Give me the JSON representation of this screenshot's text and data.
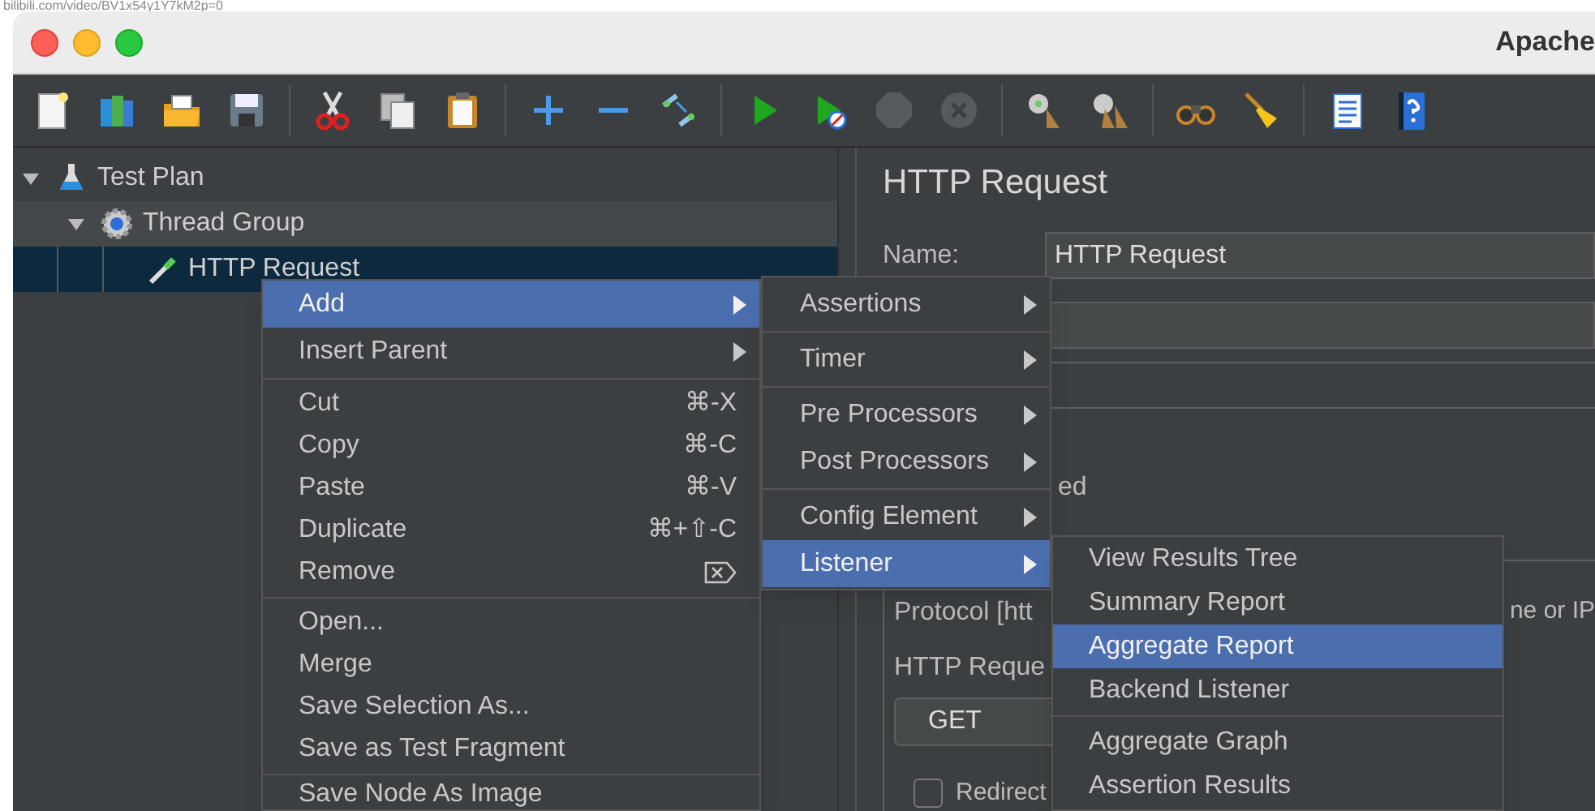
{
  "browser_strip": {
    "url": "bilibili.com/video/BV1x54y1Y7kM2p=0"
  },
  "window": {
    "title": "Apache"
  },
  "toolbar": [
    {
      "kind": "new",
      "disabled": false
    },
    {
      "kind": "templates",
      "disabled": false
    },
    {
      "kind": "open",
      "disabled": false
    },
    {
      "kind": "save",
      "disabled": false
    },
    {
      "kind": "separator"
    },
    {
      "kind": "cut",
      "disabled": false
    },
    {
      "kind": "copy",
      "disabled": false
    },
    {
      "kind": "paste",
      "disabled": false
    },
    {
      "kind": "separator"
    },
    {
      "kind": "expand",
      "disabled": false
    },
    {
      "kind": "collapse",
      "disabled": false
    },
    {
      "kind": "toggle",
      "disabled": false
    },
    {
      "kind": "separator"
    },
    {
      "kind": "start",
      "disabled": false
    },
    {
      "kind": "start-no-pause",
      "disabled": false
    },
    {
      "kind": "stop",
      "disabled": true
    },
    {
      "kind": "shutdown",
      "disabled": true
    },
    {
      "kind": "separator"
    },
    {
      "kind": "clear",
      "disabled": false
    },
    {
      "kind": "clear-all",
      "disabled": false
    },
    {
      "kind": "separator"
    },
    {
      "kind": "search",
      "disabled": false
    },
    {
      "kind": "reset-search",
      "disabled": false
    },
    {
      "kind": "separator"
    },
    {
      "kind": "function-helper",
      "disabled": false
    },
    {
      "kind": "help",
      "disabled": false
    }
  ],
  "tree": [
    {
      "label": "Test Plan",
      "kind": "test-plan",
      "expanded": true,
      "selected": false,
      "children": [
        {
          "label": "Thread Group",
          "kind": "thread-group",
          "expanded": true,
          "selected": false,
          "children": [
            {
              "label": "HTTP Request",
              "kind": "sampler",
              "selected": true
            }
          ]
        }
      ]
    }
  ],
  "editor": {
    "title": "HTTP Request",
    "name_label": "Name:",
    "name_value": "HTTP Request",
    "row_fragment": "ed",
    "protocol_label": "Protocol [htt",
    "server_label_fragment": "ne or IP",
    "section_label": "HTTP Reque",
    "method_value": "GET",
    "redirect": {
      "label": "Redirect",
      "checked": false
    }
  },
  "context_menu": {
    "groups": [
      [
        {
          "label": "Add",
          "kind": "submenu",
          "selected": true
        },
        {
          "label": "Insert Parent",
          "kind": "submenu",
          "selected": false
        }
      ],
      [
        {
          "label": "Cut",
          "kind": "shortcut",
          "shortcut": "⌘-X",
          "selected": false
        },
        {
          "label": "Copy",
          "kind": "shortcut",
          "shortcut": "⌘-C",
          "selected": false
        },
        {
          "label": "Paste",
          "kind": "shortcut",
          "shortcut": "⌘-V",
          "selected": false
        },
        {
          "label": "Duplicate",
          "kind": "shortcut",
          "shortcut": "⌘+⇧-C",
          "selected": false
        },
        {
          "label": "Remove",
          "kind": "delete-shortcut",
          "selected": false
        }
      ],
      [
        {
          "label": "Open...",
          "kind": "plain",
          "selected": false
        },
        {
          "label": "Merge",
          "kind": "plain",
          "selected": false
        },
        {
          "label": "Save Selection As...",
          "kind": "plain",
          "selected": false
        },
        {
          "label": "Save as Test Fragment",
          "kind": "plain",
          "selected": false
        }
      ],
      [
        {
          "label": "Save Node As Image",
          "kind": "plain",
          "selected": false
        }
      ]
    ]
  },
  "add_submenu": {
    "groups": [
      [
        {
          "label": "Assertions",
          "kind": "submenu",
          "selected": false
        }
      ],
      [
        {
          "label": "Timer",
          "kind": "submenu",
          "selected": false
        }
      ],
      [
        {
          "label": "Pre Processors",
          "kind": "submenu",
          "selected": false
        },
        {
          "label": "Post Processors",
          "kind": "submenu",
          "selected": false
        }
      ],
      [
        {
          "label": "Config Element",
          "kind": "submenu",
          "selected": false
        },
        {
          "label": "Listener",
          "kind": "submenu",
          "selected": true
        }
      ]
    ]
  },
  "listener_submenu": {
    "groups": [
      [
        {
          "label": "View Results Tree",
          "selected": false
        },
        {
          "label": "Summary Report",
          "selected": false
        },
        {
          "label": "Aggregate Report",
          "selected": true
        },
        {
          "label": "Backend Listener",
          "selected": false
        }
      ],
      [
        {
          "label": "Aggregate Graph",
          "selected": false
        },
        {
          "label": "Assertion Results",
          "selected": false
        }
      ]
    ]
  }
}
